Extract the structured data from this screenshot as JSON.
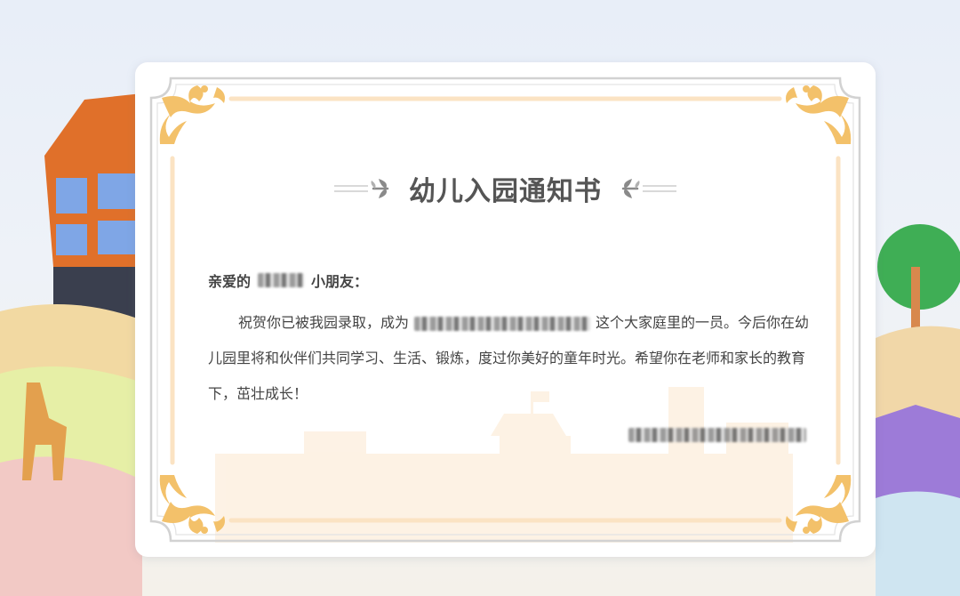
{
  "notice": {
    "title": "幼儿入园通知书",
    "greeting_prefix": "亲爱的",
    "greeting_suffix": "小朋友：",
    "body_part1": "祝贺你已被我园录取，成为",
    "body_part2": "这个大家庭里的一员。今后你在幼儿园里将和伙伴们共同学习、生活、锻炼，度过你美好的童年时光。希望你在老师和家长的教育下，茁壮成长！"
  },
  "colors": {
    "frame_gold": "#f3c16a",
    "frame_gray": "#d2d2d2",
    "inner_line": "#fbe3c3",
    "title_text": "#555555"
  },
  "icons": [
    "corner-flourish-icon",
    "title-leaf-icon"
  ]
}
